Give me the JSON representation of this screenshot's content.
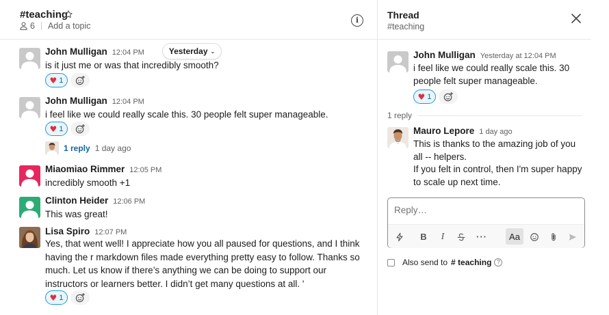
{
  "channel": {
    "name": "#teaching",
    "member_count": "6",
    "topic_placeholder": "Add a topic",
    "date_pill": "Yesterday",
    "messages": [
      {
        "author": "John Mulligan",
        "time": "12:04 PM",
        "text": "is it just me or was that incredibly smooth?",
        "reaction_count": "1",
        "avatar": "default-gray"
      },
      {
        "author": "John Mulligan",
        "time": "12:04 PM",
        "text": "i feel like we could really scale this. 30 people felt super manageable.",
        "reaction_count": "1",
        "avatar": "default-gray",
        "replies": {
          "count_label": "1 reply",
          "last_reply": "1 day ago"
        }
      },
      {
        "author": "Miaomiao Rimmer",
        "time": "12:05 PM",
        "text": "incredibly smooth +1",
        "avatar": "default-pink"
      },
      {
        "author": "Clinton Heider",
        "time": "12:06 PM",
        "text": "This was great!",
        "avatar": "default-green"
      },
      {
        "author": "Lisa Spiro",
        "time": "12:07 PM",
        "text": "Yes, that went well! I appreciate how you all paused for questions, and I think having the r markdown files made everything pretty easy to follow. Thanks so much. Let us know if there’s anything we can be doing to support our instructors or learners better. I didn’t get many questions at all. '",
        "reaction_count": "1",
        "avatar": "photo"
      }
    ]
  },
  "thread": {
    "title": "Thread",
    "channel": "#teaching",
    "parent": {
      "author": "John Mulligan",
      "time": "Yesterday at 12:04 PM",
      "text": "i feel like we could really scale this. 30 people felt super manageable.",
      "reaction_count": "1"
    },
    "reply_divider": "1 reply",
    "reply": {
      "author": "Mauro Lepore",
      "time": "1 day ago",
      "text_1": "This is thanks to the amazing job of you all -- helpers.",
      "text_2": "If you felt in control, then I'm super happy to scale up next time."
    },
    "composer": {
      "placeholder": "Reply…",
      "format_label": "Aa"
    },
    "also_send": {
      "label": "Also send to",
      "channel": "# teaching"
    }
  },
  "colors": {
    "link": "#1264a3",
    "reaction_border": "#1d9bd1",
    "reaction_bg": "#e8f5fa",
    "avatar_pink": "#e8265e",
    "avatar_green": "#2bac76",
    "avatar_gray": "#c9c9c9"
  },
  "icons": [
    "star-icon",
    "person-icon",
    "info-icon",
    "heart-icon",
    "add-reaction-icon",
    "chevron-down-icon",
    "close-icon",
    "lightning-icon",
    "bold-icon",
    "italic-icon",
    "strikethrough-icon",
    "more-icon",
    "emoji-icon",
    "attachment-icon",
    "send-icon",
    "help-icon"
  ]
}
